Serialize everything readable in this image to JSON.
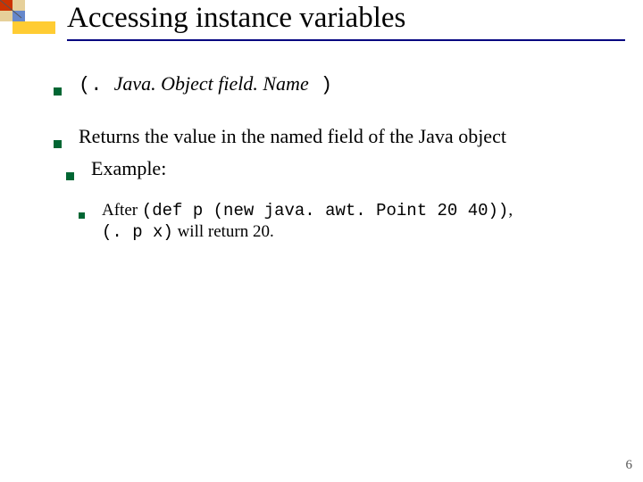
{
  "title": "Accessing instance variables",
  "bullets": {
    "b1": {
      "lp": "(. ",
      "obj": "Java. Object  field. Name",
      "rp": " )"
    },
    "b2": "Returns the value in the named field of the Java object",
    "b3": "Example:"
  },
  "nested": {
    "lead": "After ",
    "code1": "(def p (new java. awt. Point 20 40))",
    "comma": ",",
    "code2": "(. p x)",
    "tail": "  will return 20."
  },
  "page": "6"
}
